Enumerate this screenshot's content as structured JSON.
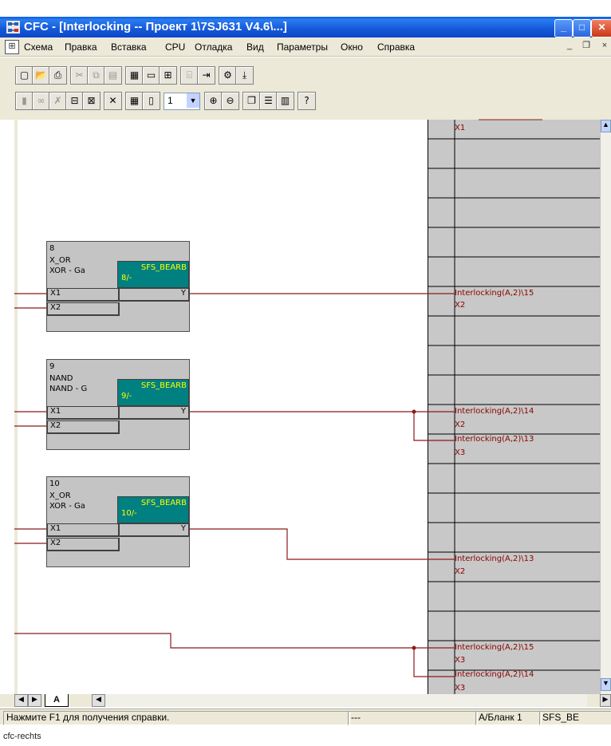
{
  "window": {
    "title": "CFC - [Interlocking -- Проект 1\\7SJ631 V4.6\\...]",
    "min": "_",
    "max": "□",
    "close": "✕"
  },
  "menu": [
    "Схема",
    "Правка",
    "Вставка",
    "CPU",
    "Отладка",
    "Вид",
    "Параметры",
    "Окно",
    "Справка"
  ],
  "mdi": {
    "min": "_",
    "restore": "❐",
    "close": "×"
  },
  "toolbar": {
    "combo_value": "1"
  },
  "blocks": [
    {
      "num": "8",
      "name": "X_OR",
      "type": "XOR - Ga",
      "tag": "SFS_BEARB",
      "subtag": "8/-",
      "in1": "X1",
      "in2": "X2",
      "out": "Y"
    },
    {
      "num": "9",
      "name": "NAND",
      "type": "NAND - G",
      "tag": "SFS_BEARB",
      "subtag": "9/-",
      "in1": "X1",
      "in2": "X2",
      "out": "Y"
    },
    {
      "num": "10",
      "name": "X_OR",
      "type": "XOR - Ga",
      "tag": "SFS_BEARB",
      "subtag": "10/-",
      "in1": "X1",
      "in2": "X2",
      "out": "Y"
    }
  ],
  "sheetrefs": [
    {
      "a": "",
      "b": "X1"
    },
    {
      "a": "Interlocking(A,2)\\15",
      "b": "X2"
    },
    {
      "a": "Interlocking(A,2)\\14",
      "b": "X2"
    },
    {
      "a": "Interlocking(A,2)\\13",
      "b": "X3"
    },
    {
      "a": "Interlocking(A,2)\\13",
      "b": "X2"
    },
    {
      "a": "Interlocking(A,2)\\15",
      "b": "X3"
    },
    {
      "a": "Interlocking(A,2)\\14",
      "b": "X3"
    }
  ],
  "tabs": {
    "sheet": "A"
  },
  "status": {
    "help": "Нажмите F1 для получения справки.",
    "mid": "---",
    "sheet": "A/Бланк 1",
    "block": "SFS_BE"
  },
  "caption": "cfc-rechts",
  "colors": {
    "wire": "#8b1a1a",
    "block_tag": "#008080",
    "tag_text": "#ffff00"
  }
}
